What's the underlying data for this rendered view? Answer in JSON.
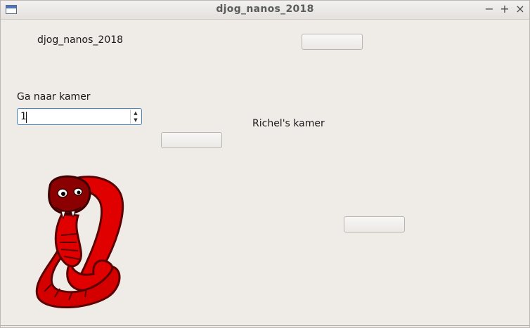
{
  "window": {
    "title": "djog_nanos_2018"
  },
  "labels": {
    "app_name": "djog_nanos_2018",
    "goto_room": "Ga naar kamer",
    "room_name": "Richel's kamer"
  },
  "spinbox": {
    "value": "1"
  },
  "buttons": {
    "top": "",
    "middle": "",
    "right": ""
  },
  "icons": {
    "app": "app-icon",
    "minimize": "minimize-icon",
    "maximize": "maximize-icon",
    "close": "close-icon",
    "snake": "cobra-snake-image"
  },
  "colors": {
    "accent": "#4a86c8",
    "snake_body": "#e00000",
    "snake_dark": "#7a0000"
  }
}
